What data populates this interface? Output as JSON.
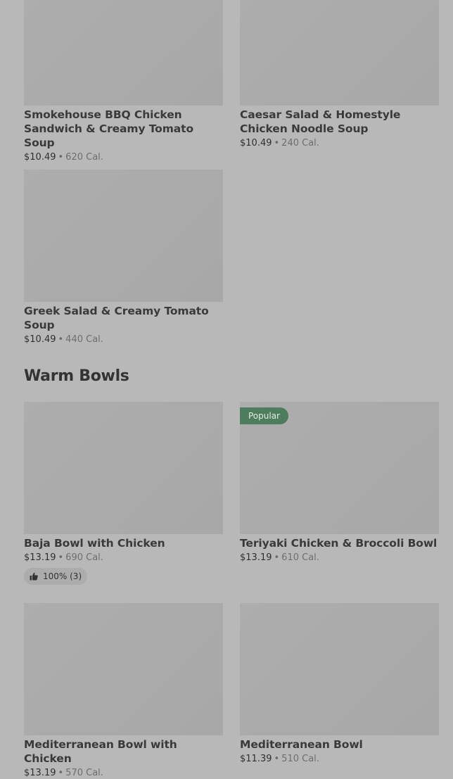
{
  "top_items": [
    {
      "name": "Smokehouse BBQ Chicken Sandwich & Creamy Tomato Soup",
      "price": "$10.49",
      "separator": "•",
      "calories": "620 Cal."
    },
    {
      "name": "Caesar Salad & Homestyle Chicken Noodle Soup",
      "price": "$10.49",
      "separator": "•",
      "calories": "240 Cal."
    },
    {
      "name": "Greek Salad & Creamy Tomato Soup",
      "price": "$10.49",
      "separator": "•",
      "calories": "440 Cal."
    }
  ],
  "warm_bowls": {
    "heading": "Warm Bowls",
    "items": [
      {
        "name": "Baja Bowl with Chicken",
        "price": "$13.19",
        "separator": "•",
        "calories": "690 Cal.",
        "rating": "100% (3)"
      },
      {
        "name": "Teriyaki Chicken & Broccoli Bowl",
        "price": "$13.19",
        "separator": "•",
        "calories": "610 Cal.",
        "badge": "Popular"
      },
      {
        "name": "Mediterranean Bowl with Chicken",
        "price": "$13.19",
        "separator": "•",
        "calories": "570 Cal."
      },
      {
        "name": "Mediterranean Bowl",
        "price": "$11.39",
        "separator": "•",
        "calories": "510 Cal."
      }
    ]
  },
  "colors": {
    "background": "#b8b8b8",
    "image_placeholder": "#aaaaaa",
    "badge": "#4d7d5c"
  },
  "icons": {
    "rating": "thumbs-up-icon"
  }
}
